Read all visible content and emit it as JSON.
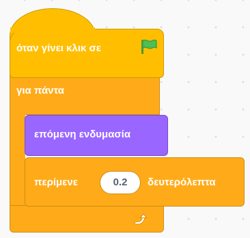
{
  "blocks": {
    "hat": {
      "label": "όταν γίνει κλικ σε",
      "icon": "green-flag-icon",
      "color": "#ffbf00"
    },
    "forever": {
      "label": "για πάντα",
      "icon": "loop-arrow-icon",
      "color": "#ffab19"
    },
    "looks": {
      "label": "επόμενη ενδυμασία",
      "color": "#9966ff"
    },
    "wait": {
      "label_before": "περίμενε",
      "value": "0.2",
      "label_after": "δευτερόλεπτα",
      "color": "#ffab19"
    }
  }
}
